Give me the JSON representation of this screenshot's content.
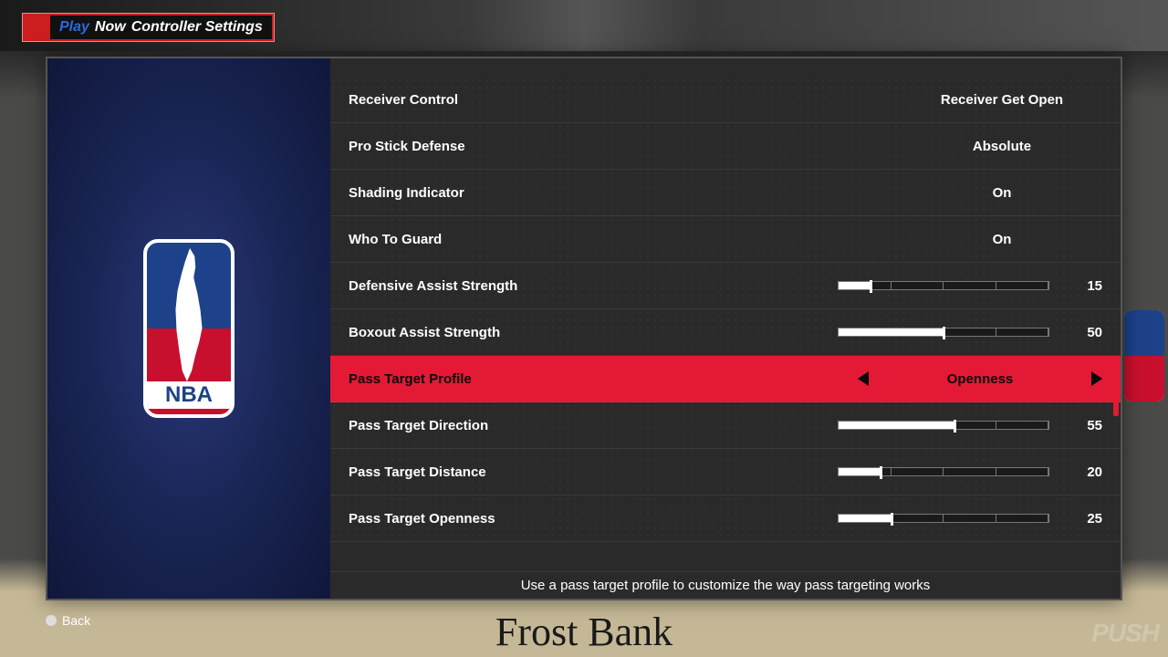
{
  "header": {
    "play": "Play",
    "now": "Now",
    "subtitle": "Controller Settings"
  },
  "settings": [
    {
      "label": "Receiver Control",
      "type": "text",
      "value": "Receiver Get Open",
      "selected": false
    },
    {
      "label": "Pro Stick Defense",
      "type": "text",
      "value": "Absolute",
      "selected": false
    },
    {
      "label": "Shading Indicator",
      "type": "text",
      "value": "On",
      "selected": false
    },
    {
      "label": "Who To Guard",
      "type": "text",
      "value": "On",
      "selected": false
    },
    {
      "label": "Defensive Assist Strength",
      "type": "slider",
      "value": 15,
      "selected": false
    },
    {
      "label": "Boxout Assist Strength",
      "type": "slider",
      "value": 50,
      "selected": false
    },
    {
      "label": "Pass Target Profile",
      "type": "text",
      "value": "Openness",
      "selected": true
    },
    {
      "label": "Pass Target Direction",
      "type": "slider",
      "value": 55,
      "selected": false
    },
    {
      "label": "Pass Target Distance",
      "type": "slider",
      "value": 20,
      "selected": false
    },
    {
      "label": "Pass Target Openness",
      "type": "slider",
      "value": 25,
      "selected": false
    }
  ],
  "description": "Use a pass target profile to customize the way pass targeting works",
  "footer": {
    "back": "Back"
  },
  "nba_label": "NBA",
  "bg_floor_text": "Frost Bank",
  "watermark": "PUSH"
}
